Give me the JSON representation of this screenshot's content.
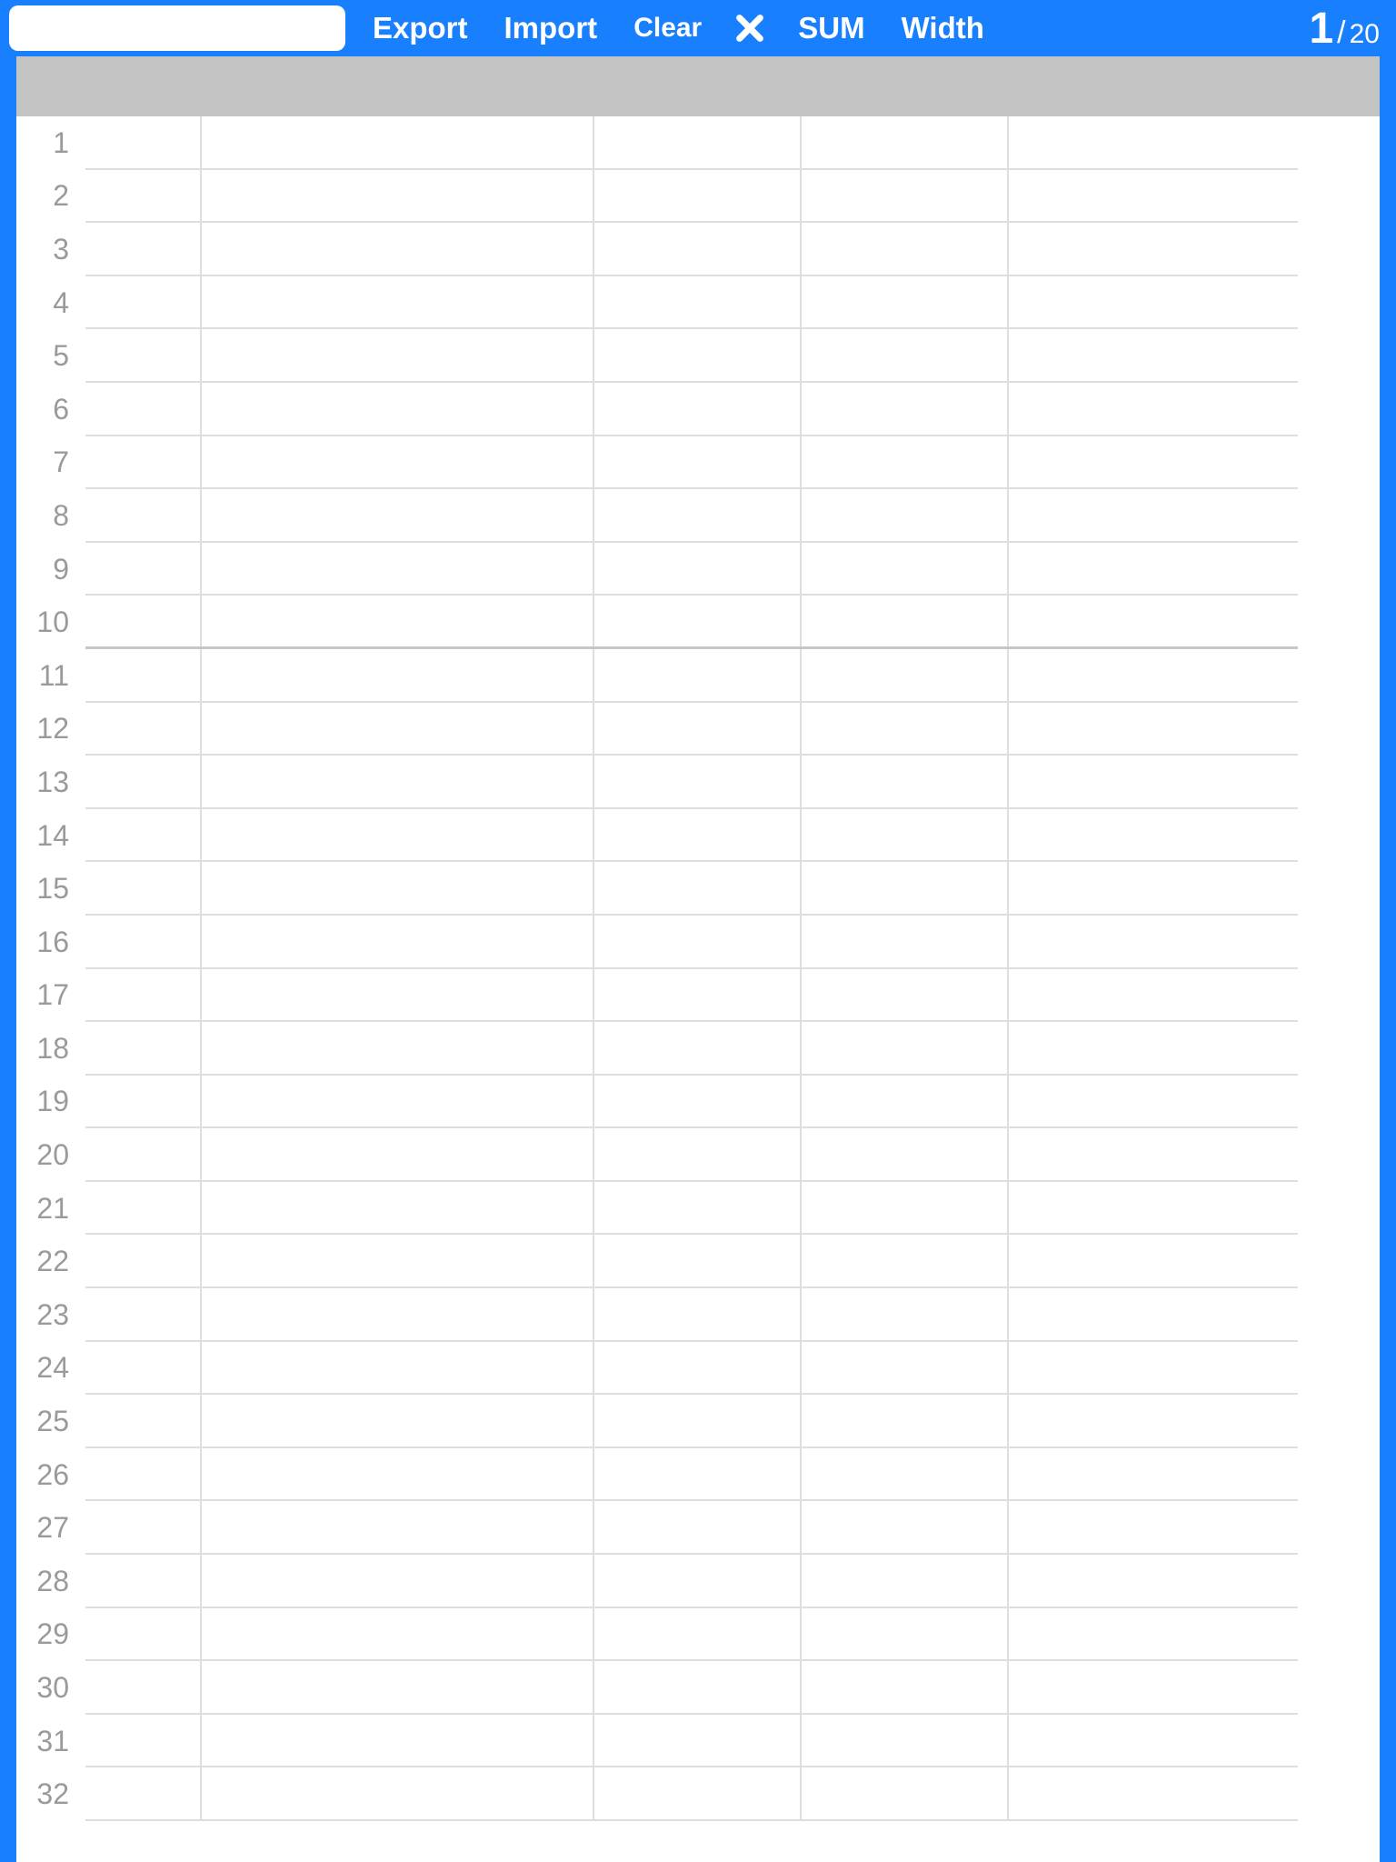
{
  "toolbar": {
    "export_label": "Export",
    "import_label": "Import",
    "clear_label": "Clear",
    "close_icon": "close-icon",
    "sum_label": "SUM",
    "width_label": "Width",
    "cell_input_value": ""
  },
  "pager": {
    "current": "1",
    "separator": "/",
    "total": "20"
  },
  "grid": {
    "row_count": 32,
    "heavy_divider_after_row": 10,
    "rows": [
      {
        "n": "1",
        "cells": [
          "",
          "",
          "",
          "",
          ""
        ]
      },
      {
        "n": "2",
        "cells": [
          "",
          "",
          "",
          "",
          ""
        ]
      },
      {
        "n": "3",
        "cells": [
          "",
          "",
          "",
          "",
          ""
        ]
      },
      {
        "n": "4",
        "cells": [
          "",
          "",
          "",
          "",
          ""
        ]
      },
      {
        "n": "5",
        "cells": [
          "",
          "",
          "",
          "",
          ""
        ]
      },
      {
        "n": "6",
        "cells": [
          "",
          "",
          "",
          "",
          ""
        ]
      },
      {
        "n": "7",
        "cells": [
          "",
          "",
          "",
          "",
          ""
        ]
      },
      {
        "n": "8",
        "cells": [
          "",
          "",
          "",
          "",
          ""
        ]
      },
      {
        "n": "9",
        "cells": [
          "",
          "",
          "",
          "",
          ""
        ]
      },
      {
        "n": "10",
        "cells": [
          "",
          "",
          "",
          "",
          ""
        ]
      },
      {
        "n": "11",
        "cells": [
          "",
          "",
          "",
          "",
          ""
        ]
      },
      {
        "n": "12",
        "cells": [
          "",
          "",
          "",
          "",
          ""
        ]
      },
      {
        "n": "13",
        "cells": [
          "",
          "",
          "",
          "",
          ""
        ]
      },
      {
        "n": "14",
        "cells": [
          "",
          "",
          "",
          "",
          ""
        ]
      },
      {
        "n": "15",
        "cells": [
          "",
          "",
          "",
          "",
          ""
        ]
      },
      {
        "n": "16",
        "cells": [
          "",
          "",
          "",
          "",
          ""
        ]
      },
      {
        "n": "17",
        "cells": [
          "",
          "",
          "",
          "",
          ""
        ]
      },
      {
        "n": "18",
        "cells": [
          "",
          "",
          "",
          "",
          ""
        ]
      },
      {
        "n": "19",
        "cells": [
          "",
          "",
          "",
          "",
          ""
        ]
      },
      {
        "n": "20",
        "cells": [
          "",
          "",
          "",
          "",
          ""
        ]
      },
      {
        "n": "21",
        "cells": [
          "",
          "",
          "",
          "",
          ""
        ]
      },
      {
        "n": "22",
        "cells": [
          "",
          "",
          "",
          "",
          ""
        ]
      },
      {
        "n": "23",
        "cells": [
          "",
          "",
          "",
          "",
          ""
        ]
      },
      {
        "n": "24",
        "cells": [
          "",
          "",
          "",
          "",
          ""
        ]
      },
      {
        "n": "25",
        "cells": [
          "",
          "",
          "",
          "",
          ""
        ]
      },
      {
        "n": "26",
        "cells": [
          "",
          "",
          "",
          "",
          ""
        ]
      },
      {
        "n": "27",
        "cells": [
          "",
          "",
          "",
          "",
          ""
        ]
      },
      {
        "n": "28",
        "cells": [
          "",
          "",
          "",
          "",
          ""
        ]
      },
      {
        "n": "29",
        "cells": [
          "",
          "",
          "",
          "",
          ""
        ]
      },
      {
        "n": "30",
        "cells": [
          "",
          "",
          "",
          "",
          ""
        ]
      },
      {
        "n": "31",
        "cells": [
          "",
          "",
          "",
          "",
          ""
        ]
      },
      {
        "n": "32",
        "cells": [
          "",
          "",
          "",
          "",
          ""
        ]
      }
    ]
  }
}
